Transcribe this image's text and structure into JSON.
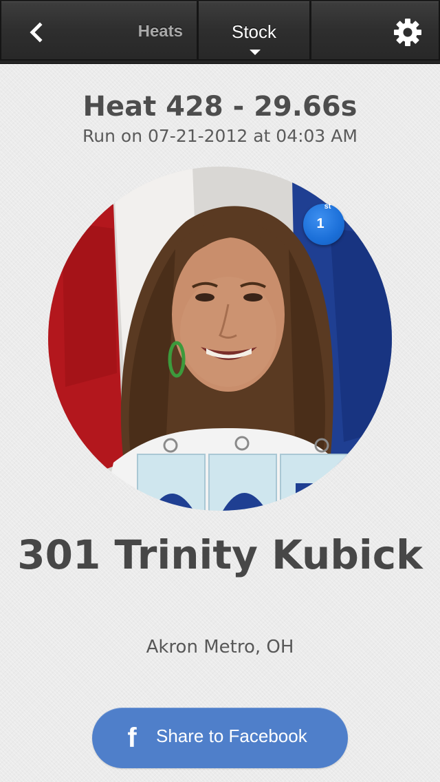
{
  "nav": {
    "back_icon": "chevron-left-icon",
    "heats_label": "Heats",
    "stock_label": "Stock",
    "settings_icon": "gear-icon"
  },
  "heat": {
    "title": "Heat 428 - 29.66s",
    "subtitle": "Run on 07-21-2012 at 04:03 AM"
  },
  "racer": {
    "photo_icon": "racer-photo",
    "place_number": "1",
    "place_suffix": "st",
    "name": "301 Trinity Kubick",
    "location": "Akron Metro, OH"
  },
  "share": {
    "icon": "facebook-icon",
    "label": "Share to Facebook"
  },
  "colors": {
    "navbar": "#2f2f2f",
    "background": "#ebebeb",
    "text_dark": "#474747",
    "badge_blue": "#1b6fd8",
    "facebook_blue": "#4f7fca"
  }
}
